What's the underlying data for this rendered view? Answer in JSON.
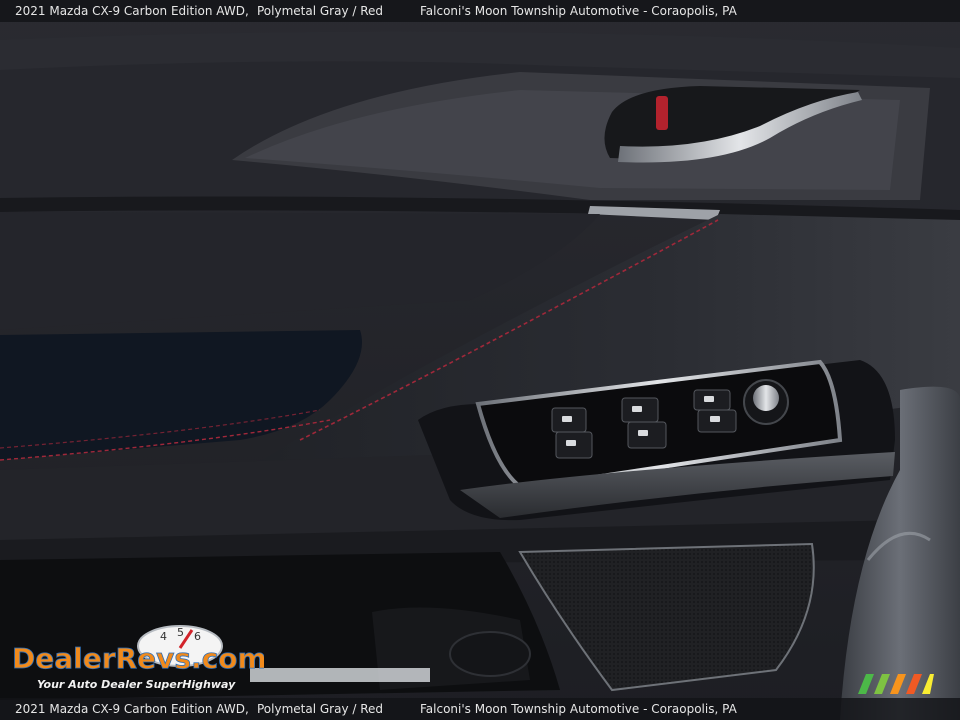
{
  "caption": {
    "vehicle": "2021 Mazda CX-9 Carbon Edition AWD,",
    "colors": "Polymetal Gray / Red",
    "dealer": "Falconi's Moon Township Automotive - Coraopolis, PA"
  },
  "watermark": {
    "brand": "DealerRevs.com",
    "tagline": "Your Auto Dealer SuperHighway",
    "gauge_digits": [
      "4",
      "5",
      "6"
    ]
  },
  "colors": {
    "panel": "#1c1d21",
    "stitching": "#a0283a",
    "chrome": "#c9ccd1",
    "logo_orange": "#f08a1c",
    "logo_blue": "#2f6fb7"
  }
}
